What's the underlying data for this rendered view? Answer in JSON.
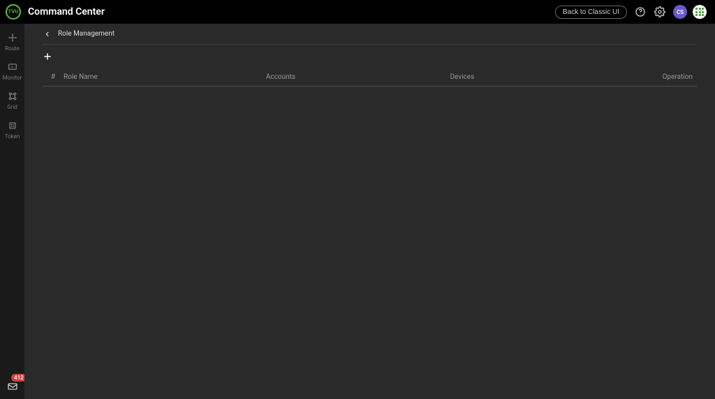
{
  "header": {
    "logo_text": "TVU",
    "app_title": "Command Center",
    "classic_btn": "Back to Classic UI",
    "avatar_initials": "CS"
  },
  "sidebar": {
    "items": [
      {
        "label": "Route"
      },
      {
        "label": "Monitor"
      },
      {
        "label": "Grid"
      },
      {
        "label": "Token"
      }
    ],
    "mail_badge": "412"
  },
  "main": {
    "page_title": "Role Management",
    "columns": {
      "num": "#",
      "name": "Role Name",
      "accounts": "Accounts",
      "devices": "Devices",
      "operation": "Operation"
    }
  }
}
